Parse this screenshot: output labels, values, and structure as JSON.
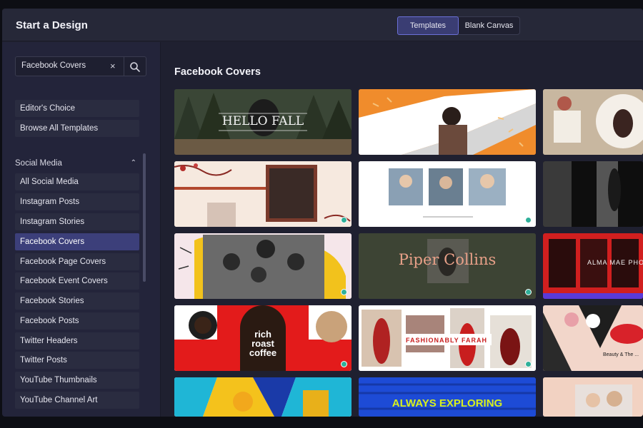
{
  "header": {
    "title": "Start a Design",
    "tabs": [
      "Templates",
      "Blank Canvas"
    ]
  },
  "search": {
    "value": "Facebook Covers",
    "clear_icon": "×"
  },
  "sidebar": {
    "top_items": [
      "Editor's Choice",
      "Browse All Templates"
    ],
    "section_label": "Social Media",
    "section_chevron": "⌃",
    "items": [
      "All Social Media",
      "Instagram Posts",
      "Instagram Stories",
      "Facebook Covers",
      "Facebook Page Covers",
      "Facebook Event Covers",
      "Facebook Stories",
      "Facebook Posts",
      "Twitter Headers",
      "Twitter Posts",
      "YouTube Thumbnails",
      "YouTube Channel Art"
    ],
    "active_item": "Facebook Covers"
  },
  "content": {
    "title": "Facebook Covers",
    "cards": {
      "hello_fall": "HELLO FALL",
      "piper_collins": "Piper Collins",
      "rich_roast_coffee": "rich roast coffee",
      "fashionably_farah": "FASHIONABLY FARAH",
      "alma_mae": "ALMA MAE PHOTO",
      "beauty": "Beauty & The ...",
      "always_exploring": "ALWAYS EXPLORING"
    }
  },
  "colors": {
    "accent": "#3c3f7a",
    "accent_border": "#6b70d8",
    "badge": "#2fb09a",
    "background": "#1f2030"
  }
}
